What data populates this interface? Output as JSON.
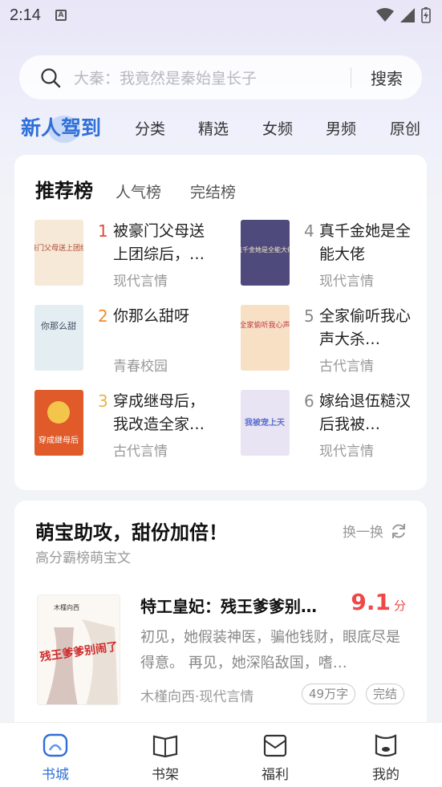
{
  "status": {
    "time": "2:14",
    "sim_label": "A"
  },
  "search": {
    "placeholder": "大秦：我竟然是秦始皇长子",
    "button": "搜索"
  },
  "tabs": [
    {
      "label": "新人驾到",
      "active": true
    },
    {
      "label": "分类"
    },
    {
      "label": "精选"
    },
    {
      "label": "女频"
    },
    {
      "label": "男频"
    },
    {
      "label": "原创"
    }
  ],
  "ranking": {
    "tabs": [
      "推荐榜",
      "人气榜",
      "完结榜"
    ],
    "items": [
      {
        "num": "1",
        "num_color": "#e8453c",
        "title": "被豪门父母送上团综后，…",
        "category": "现代言情",
        "cover_text": "被豪门父母送上团综后",
        "cover_color": "#f6e9d8"
      },
      {
        "num": "2",
        "num_color": "#f28a2e",
        "title": "你那么甜呀",
        "category": "青春校园",
        "cover_text": "你那么甜",
        "cover_color": "#e4eef2"
      },
      {
        "num": "3",
        "num_color": "#e8b24a",
        "title": "穿成继母后，我改造全家…",
        "category": "古代言情",
        "cover_text": "穿成继母后",
        "cover_color": "#e05a2a"
      },
      {
        "num": "4",
        "num_color": "#888888",
        "title": "真千金她是全能大佬",
        "category": "现代言情",
        "cover_text": "真千金她是全能大佬",
        "cover_color": "#4e4a7c"
      },
      {
        "num": "5",
        "num_color": "#888888",
        "title": "全家偷听我心声大杀…",
        "category": "古代言情",
        "cover_text": "全家偷听我心声",
        "cover_color": "#f7e0c4"
      },
      {
        "num": "6",
        "num_color": "#888888",
        "title": "嫁给退伍糙汉后我被…",
        "category": "现代言情",
        "cover_text": "我被宠上天",
        "cover_color": "#e9e4f3"
      }
    ]
  },
  "recommend": {
    "heading": "萌宝助攻，甜份加倍！",
    "subheading": "高分霸榜萌宝文",
    "swap_label": "换一换",
    "book": {
      "title": "特工皇妃：残王爹爹别…",
      "score": "9.1",
      "score_unit": "分",
      "desc": "初见，她假装神医，骗他钱财，眼底尽是得意。 再见，她深陷敌国，嗜…",
      "meta": "木槿向西·现代言情",
      "tags": [
        "49万字",
        "完结"
      ],
      "cover_text": "残王爹爹别闹了",
      "cover_author": "木槿向西"
    }
  },
  "bottom_nav": [
    {
      "label": "书城",
      "active": true
    },
    {
      "label": "书架"
    },
    {
      "label": "福利"
    },
    {
      "label": "我的"
    }
  ]
}
